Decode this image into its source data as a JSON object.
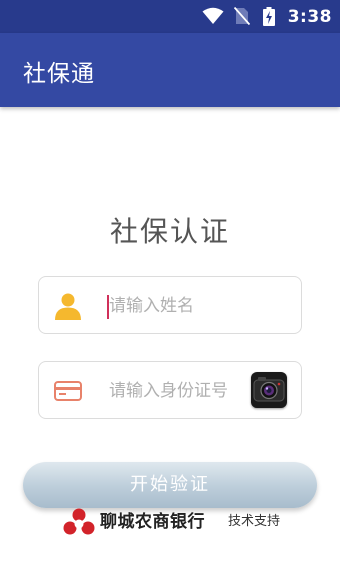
{
  "status_bar": {
    "time": "3:38",
    "icons": [
      "wifi-icon",
      "no-sim-icon",
      "battery-charging-icon"
    ]
  },
  "app_bar": {
    "title": "社保通"
  },
  "main": {
    "heading": "社保认证",
    "name_field": {
      "placeholder": "请输入姓名",
      "value": "",
      "icon": "person-icon"
    },
    "id_field": {
      "placeholder": "请输入身份证号",
      "value": "",
      "icon": "id-card-icon",
      "action_icon": "camera-icon"
    },
    "submit_label": "开始验证"
  },
  "footer": {
    "logo_icon": "bank-logo-icon",
    "bank_name": "聊城农商银行",
    "support_text": "技术支持"
  },
  "colors": {
    "status_bar": "#283a8c",
    "app_bar": "#3449a3",
    "person_icon": "#f5b82e",
    "id_card_icon": "#e8826a",
    "cursor": "#d0305a",
    "logo": "#d2232a"
  }
}
